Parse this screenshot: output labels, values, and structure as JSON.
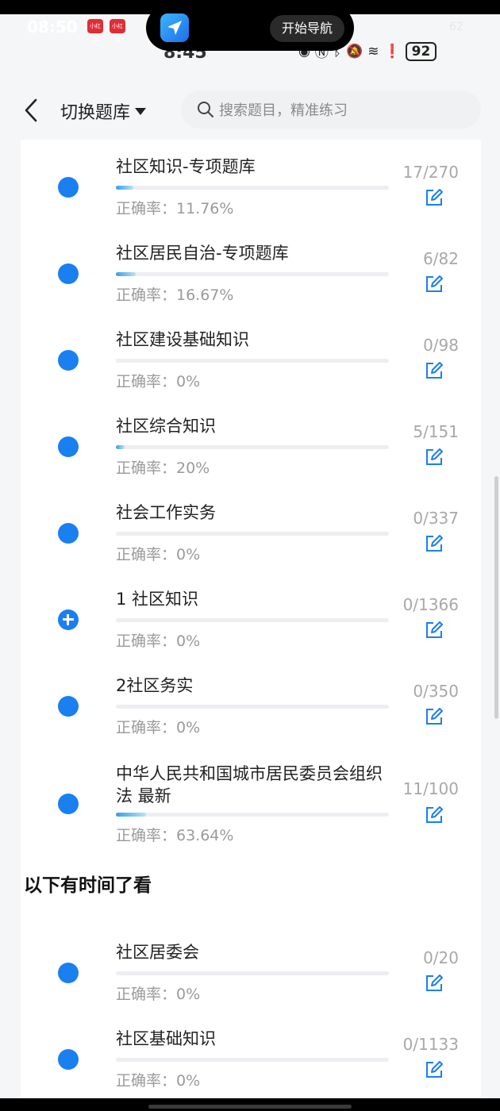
{
  "status": {
    "bg_time": "08:50",
    "mini_badge": "小红书",
    "time": "8:45",
    "battery": "92",
    "signal": "62"
  },
  "island": {
    "nav_button": "开始导航"
  },
  "nav": {
    "bank_switch": "切换题库",
    "search_placeholder": "搜索题目，精准练习"
  },
  "items": [
    {
      "title": "社区知识-专项题库",
      "accuracy": "正确率：11.76%",
      "count": "17/270",
      "progress": 0.063
    },
    {
      "title": "社区居民自治-专项题库",
      "accuracy": "正确率：16.67%",
      "count": "6/82",
      "progress": 0.073
    },
    {
      "title": "社区建设基础知识",
      "accuracy": "正确率：0%",
      "count": "0/98",
      "progress": 0
    },
    {
      "title": "社区综合知识",
      "accuracy": "正确率：20%",
      "count": "5/151",
      "progress": 0.033
    },
    {
      "title": "社会工作实务",
      "accuracy": "正确率：0%",
      "count": "0/337",
      "progress": 0
    },
    {
      "title": "1 社区知识",
      "accuracy": "正确率：0%",
      "count": "0/1366",
      "progress": 0
    },
    {
      "title": "2社区务实",
      "accuracy": "正确率：0%",
      "count": "0/350",
      "progress": 0
    },
    {
      "title": "中华人民共和国城市居民委员会组织法 最新",
      "accuracy": "正确率：63.64%",
      "count": "11/100",
      "progress": 0.11
    }
  ],
  "section": {
    "heading": "以下有时间了看"
  },
  "items2": [
    {
      "title": "社区居委会",
      "accuracy": "正确率：0%",
      "count": "0/20",
      "progress": 0
    },
    {
      "title": "社区基础知识",
      "accuracy": "正确率：0%",
      "count": "0/1133",
      "progress": 0
    }
  ]
}
